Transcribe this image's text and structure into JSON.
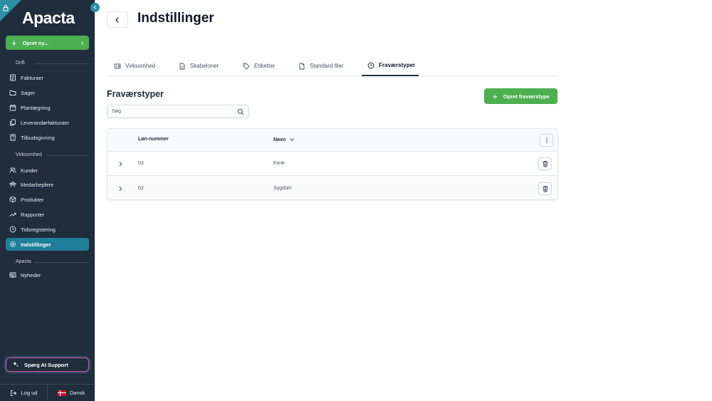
{
  "app": {
    "logo_text": "Apacta"
  },
  "sidebar": {
    "create_label": "Opret ny...",
    "sections": {
      "drift": "Drift",
      "virksomhed": "Virksomhed",
      "apacta": "Apacta"
    },
    "drift_items": [
      {
        "label": "Fakturaer",
        "icon": "folder-icon"
      },
      {
        "label": "Sager",
        "icon": "folder-open-icon"
      },
      {
        "label": "Planlægning",
        "icon": "calendar-icon"
      },
      {
        "label": "Leverandørfakturaer",
        "icon": "documents-icon"
      },
      {
        "label": "Tilbudsgivning",
        "icon": "calculator-icon"
      }
    ],
    "virksomhed_items": [
      {
        "label": "Kunder",
        "icon": "users-icon"
      },
      {
        "label": "Medarbejdere",
        "icon": "team-icon"
      },
      {
        "label": "Produkter",
        "icon": "box-icon"
      },
      {
        "label": "Rapporter",
        "icon": "trend-icon"
      },
      {
        "label": "Tidsregistering",
        "icon": "clock-icon"
      },
      {
        "label": "Indstillinger",
        "icon": "settings-icon",
        "active": true
      }
    ],
    "apacta_items": [
      {
        "label": "Nyheder",
        "icon": "newspaper-icon"
      }
    ],
    "ai_support_label": "Spørg AI Support",
    "logout_label": "Log ud",
    "language_label": "Dansk"
  },
  "header": {
    "title": "Indstillinger"
  },
  "tabs": [
    {
      "label": "Virksomhed",
      "icon": "id-card-icon"
    },
    {
      "label": "Skabeloner",
      "icon": "document-icon"
    },
    {
      "label": "Etiketter",
      "icon": "tag-icon"
    },
    {
      "label": "Standard filer",
      "icon": "file-icon"
    },
    {
      "label": "Fraværstyper",
      "icon": "clock-icon",
      "active": true
    }
  ],
  "main": {
    "section_title": "Fraværstyper",
    "create_button_label": "Opret fraværstype",
    "search_placeholder": "Søg"
  },
  "table": {
    "columns": [
      "Løn-nummer",
      "Navn"
    ],
    "rows": [
      {
        "number": "03",
        "name": "Ferie"
      },
      {
        "number": "02",
        "name": "Sygdom"
      }
    ]
  },
  "colors": {
    "sidebar_bg": "#1f2d3d",
    "active_item": "#1f7e9a",
    "primary_green": "#4caf50",
    "accent_teal": "#2b8fa3"
  }
}
